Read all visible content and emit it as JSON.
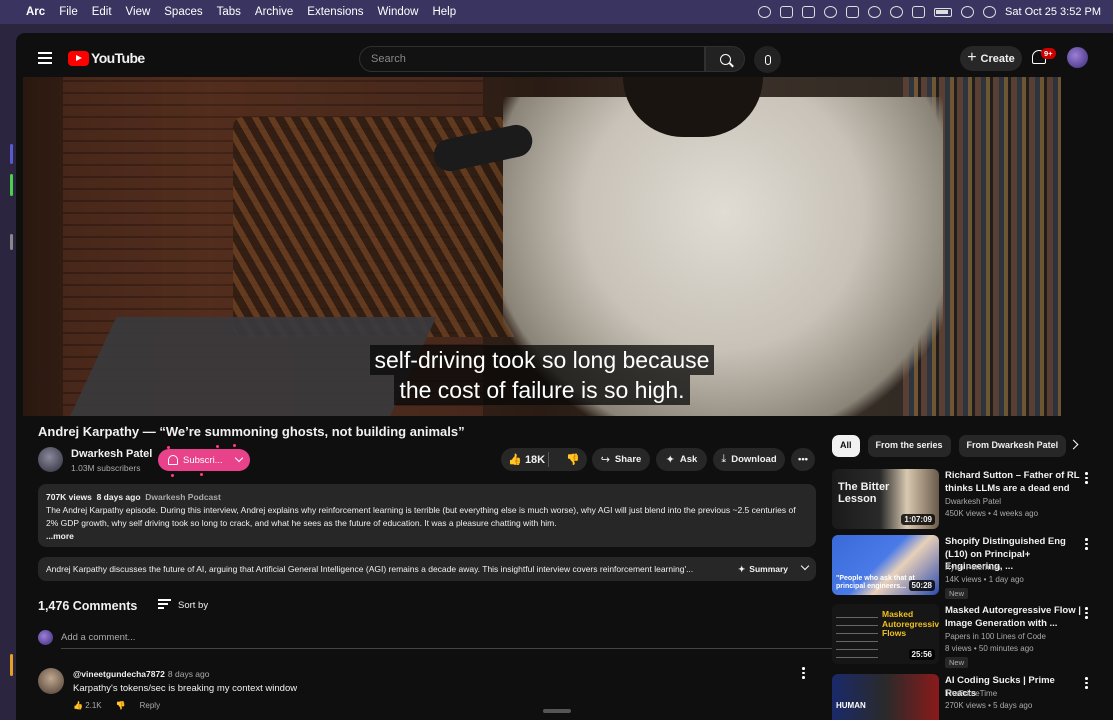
{
  "mac": {
    "app": "Arc",
    "menus": [
      "File",
      "Edit",
      "View",
      "Spaces",
      "Tabs",
      "Archive",
      "Extensions",
      "Window",
      "Help"
    ],
    "datetime": "Sat Oct 25  3:52 PM"
  },
  "header": {
    "logo_text": "YouTube",
    "search_placeholder": "Search",
    "create_label": "Create",
    "notif_badge": "9+"
  },
  "video": {
    "subtitle_line1": "self-driving took so long because",
    "subtitle_line2": "the cost of failure is so high.",
    "title": "Andrej Karpathy — “We’re summoning ghosts, not building animals”"
  },
  "channel": {
    "name": "Dwarkesh Patel",
    "subscribers": "1.03M subscribers",
    "subscribe_label": "Subscri..."
  },
  "actions": {
    "likes": "18K",
    "share": "Share",
    "ask": "Ask",
    "download": "Download"
  },
  "description": {
    "views": "707K views",
    "age": "8 days ago",
    "podcast": "Dwarkesh Podcast",
    "text": "The Andrej Karpathy episode. During this interview, Andrej explains why reinforcement learning is terrible (but everything else is much worse), why AGI will just blend into the previous ~2.5 centuries of 2% GDP growth, why self driving took so long to crack, and what he sees as the future of education. It was a pleasure chatting with him.",
    "more": "...more"
  },
  "summary": {
    "text": "Andrej Karpathy discusses the future of AI, arguing that Artificial General Intelligence (AGI) remains a decade away. This insightful interview covers reinforcement learning'...",
    "button": "Summary"
  },
  "comments": {
    "count": "1,476 Comments",
    "sort": "Sort by",
    "add_placeholder": "Add a comment...",
    "first": {
      "user": "@vineetgundecha7872",
      "age": "8 days ago",
      "text": "Karpathy's tokens/sec is breaking my context window",
      "likes": "2.1K",
      "reply": "Reply"
    }
  },
  "chips": [
    "All",
    "From the series",
    "From Dwarkesh Patel"
  ],
  "recommendations": [
    {
      "title": "Richard Sutton – Father of RL thinks LLMs are a dead end",
      "channel": "Dwarkesh Patel",
      "stats": "450K views • 4 weeks ago",
      "duration": "1:07:09",
      "thumb_text": "The Bitter Lesson",
      "new": ""
    },
    {
      "title": "Shopify Distinguished Eng (L10) on Principal+ Engineering, ...",
      "channel": "Ryan Peterman",
      "stats": "14K views • 1 day ago",
      "duration": "50:28",
      "thumb_text": "\"People who ask that at principal engineers...",
      "new": "New"
    },
    {
      "title": "Masked Autoregressive Flow | Image Generation with ...",
      "channel": "Papers in 100 Lines of Code",
      "stats": "8 views • 50 minutes ago",
      "duration": "25:56",
      "thumb_text": "Masked Autoregressive Flows",
      "new": "New"
    },
    {
      "title": "AI Coding Sucks | Prime Reacts",
      "channel": "ThePrimeTime",
      "stats": "270K views • 5 days ago",
      "duration": "",
      "thumb_text": "HUMAN",
      "new": ""
    }
  ]
}
